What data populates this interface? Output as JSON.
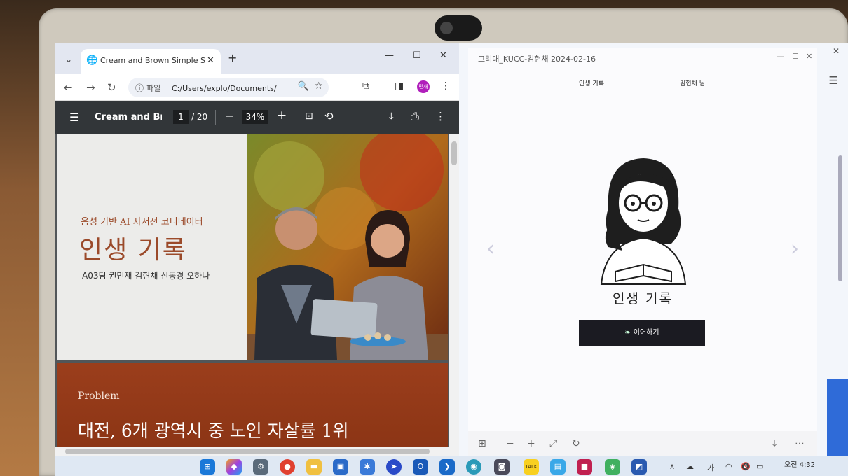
{
  "browser": {
    "tab_list": "⌄",
    "tab_title": "Cream and Brown Simple Sale",
    "address_scheme": "파일",
    "address_url": "C:/Users/explo/Documents/카카...",
    "profile_badge": "민재"
  },
  "pdf_viewer": {
    "doc_title": "Cream and Bro...",
    "page_current": "1",
    "page_total": "/ 20",
    "zoom": "34%"
  },
  "slide1": {
    "subtitle": "음성 기반 AI 자서전 코디네이터",
    "title": "인생 기록",
    "team": "A03팀 권민재 김현채 신동경 오하나"
  },
  "slide2": {
    "label": "Problem",
    "headline": "대전, 6개 광역시 중 노인 자살률 1위"
  },
  "app": {
    "window_title": "고려대_KUCC-김현채 2024-02-16",
    "nav_left": "인생 기록",
    "nav_right": "김현채 님",
    "main_title": "인생 기록",
    "cta_label": "이어하기"
  },
  "taskbar": {
    "ime": "가",
    "time": "오전 4:32"
  },
  "colors": {
    "accent_brown": "#9b4a2a",
    "pdf_toolbar": "#323639",
    "cta_dark": "#1b1b22",
    "profile": "#b01fbb"
  }
}
